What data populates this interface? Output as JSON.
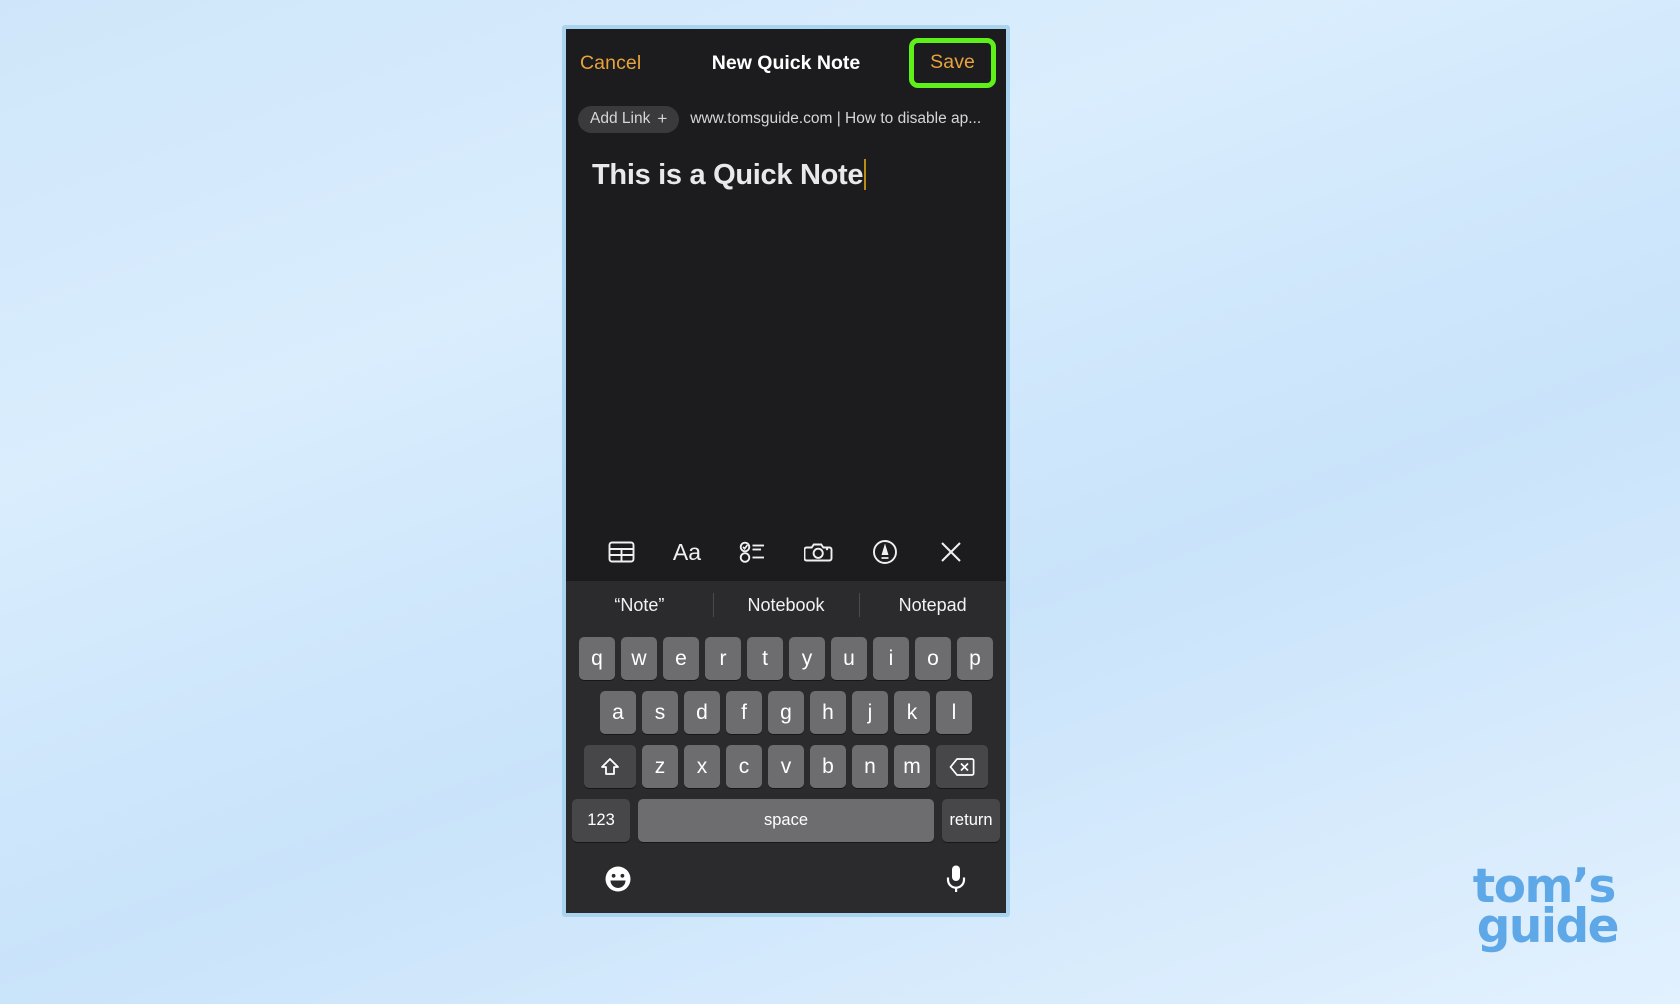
{
  "window": {
    "background_color": "#cfe6fa",
    "device_frame_color": "#a9d4ef"
  },
  "navbar": {
    "cancel_label": "Cancel",
    "title": "New Quick Note",
    "save_label": "Save",
    "accent_color": "#e8a33d",
    "highlight_color": "#5ef018"
  },
  "link_row": {
    "add_link_label": "Add Link",
    "add_link_plus": "+",
    "url_text": "www.tomsguide.com | How to disable ap..."
  },
  "note": {
    "title_text": "This is a Quick Note",
    "caret_color": "#b98b17"
  },
  "editor_toolbar": {
    "items": [
      {
        "name": "table-icon",
        "label": "Table"
      },
      {
        "name": "format-aa-icon",
        "label": "Aa"
      },
      {
        "name": "checklist-icon",
        "label": "Checklist"
      },
      {
        "name": "camera-icon",
        "label": "Camera"
      },
      {
        "name": "markup-pen-icon",
        "label": "Markup"
      },
      {
        "name": "close-icon",
        "label": "Close"
      }
    ]
  },
  "predictive_bar": {
    "suggestions": [
      "“Note”",
      "Notebook",
      "Notepad"
    ]
  },
  "keyboard": {
    "row1": [
      "q",
      "w",
      "e",
      "r",
      "t",
      "y",
      "u",
      "i",
      "o",
      "p"
    ],
    "row2": [
      "a",
      "s",
      "d",
      "f",
      "g",
      "h",
      "j",
      "k",
      "l"
    ],
    "row3_shift": "shift-icon",
    "row3": [
      "z",
      "x",
      "c",
      "v",
      "b",
      "n",
      "m"
    ],
    "row3_delete": "delete-icon",
    "numbers_key": "123",
    "space_key": "space",
    "return_key": "return"
  },
  "bottom_bar": {
    "emoji_label": "emoji-icon",
    "dictation_label": "microphone-icon"
  },
  "watermark": {
    "line1": "tom’s",
    "line2": "guide",
    "color": "#5fa8e8"
  }
}
